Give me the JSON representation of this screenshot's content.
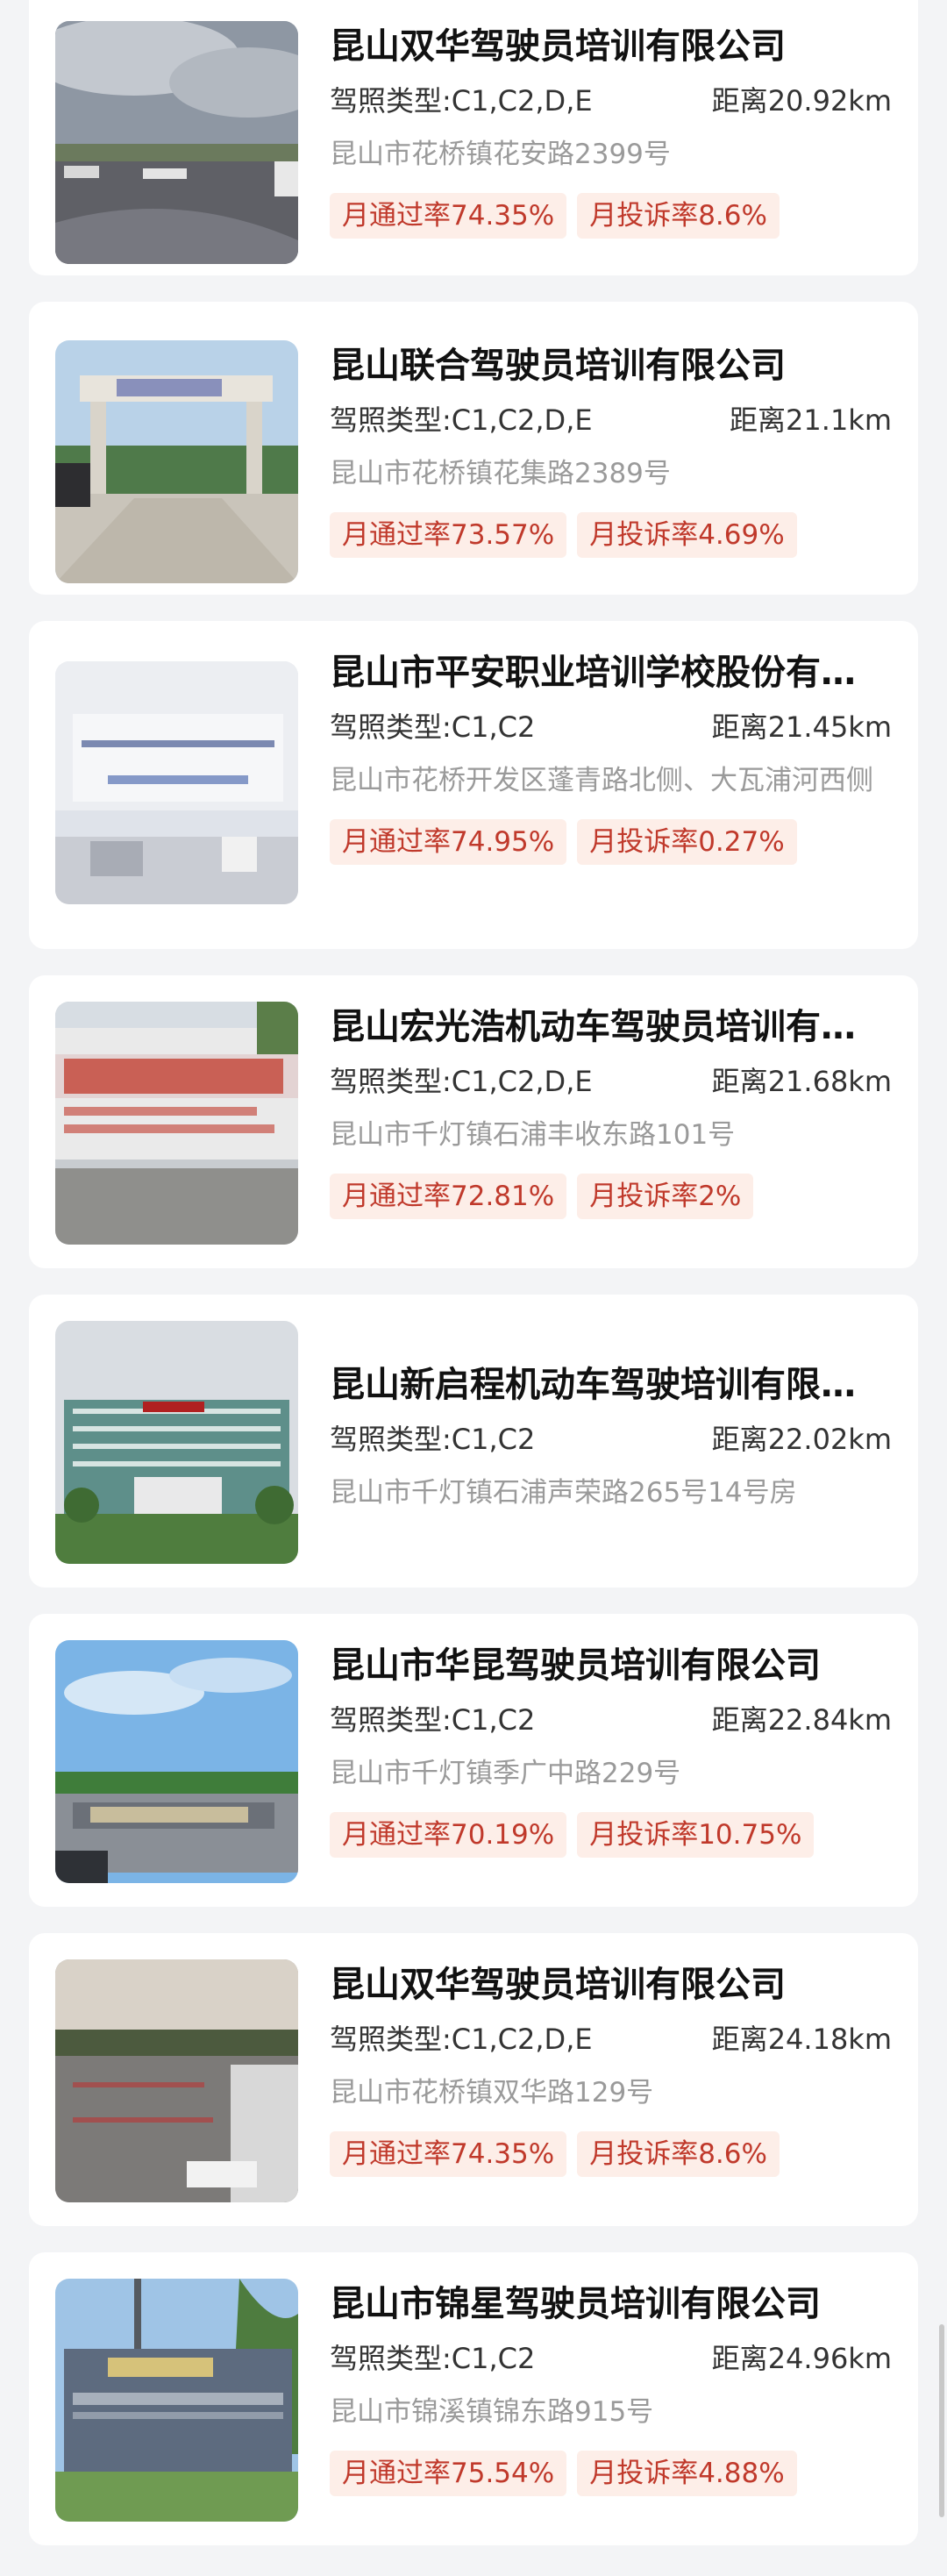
{
  "labels": {
    "license_prefix": "驾照类型:",
    "distance_prefix": "距离",
    "pass_prefix": "月通过率",
    "complaint_prefix": "月投诉率"
  },
  "schools": [
    {
      "name": "昆山双华驾驶员培训有限公司",
      "license": "C1,C2,D,E",
      "distance": "20.92km",
      "address": "昆山市花桥镇花安路2399号",
      "pass_rate": "74.35%",
      "complaint_rate": "8.6%",
      "photo": "parking-lot-photo"
    },
    {
      "name": "昆山联合驾驶员培训有限公司",
      "license": "C1,C2,D,E",
      "distance": "21.1km",
      "address": "昆山市花桥镇花集路2389号",
      "pass_rate": "73.57%",
      "complaint_rate": "4.69%",
      "photo": "gate-photo"
    },
    {
      "name": "昆山市平安职业培训学校股份有…",
      "license": "C1,C2",
      "distance": "21.45km",
      "address": "昆山市花桥开发区蓬青路北侧、大瓦浦河西侧",
      "pass_rate": "74.95%",
      "complaint_rate": "0.27%",
      "photo": "reception-photo"
    },
    {
      "name": "昆山宏光浩机动车驾驶员培训有…",
      "license": "C1,C2,D,E",
      "distance": "21.68km",
      "address": "昆山市千灯镇石浦丰收东路101号",
      "pass_rate": "72.81%",
      "complaint_rate": "2%",
      "photo": "sign-wall-photo"
    },
    {
      "name": "昆山新启程机动车驾驶培训有限…",
      "license": "C1,C2",
      "distance": "22.02km",
      "address": "昆山市千灯镇石浦声荣路265号14号房",
      "pass_rate": "",
      "complaint_rate": "",
      "photo": "building-photo"
    },
    {
      "name": "昆山市华昆驾驶员培训有限公司",
      "license": "C1,C2",
      "distance": "22.84km",
      "address": "昆山市千灯镇季广中路229号",
      "pass_rate": "70.19%",
      "complaint_rate": "10.75%",
      "photo": "name-wall-photo"
    },
    {
      "name": "昆山双华驾驶员培训有限公司",
      "license": "C1,C2,D,E",
      "distance": "24.18km",
      "address": "昆山市花桥镇双华路129号",
      "pass_rate": "74.35%",
      "complaint_rate": "8.6%",
      "photo": "training-field-photo"
    },
    {
      "name": "昆山市锦星驾驶员培训有限公司",
      "license": "C1,C2",
      "distance": "24.96km",
      "address": "昆山市锦溪镇锦东路915号",
      "pass_rate": "75.54%",
      "complaint_rate": "4.88%",
      "photo": "company-wall-photo"
    }
  ]
}
